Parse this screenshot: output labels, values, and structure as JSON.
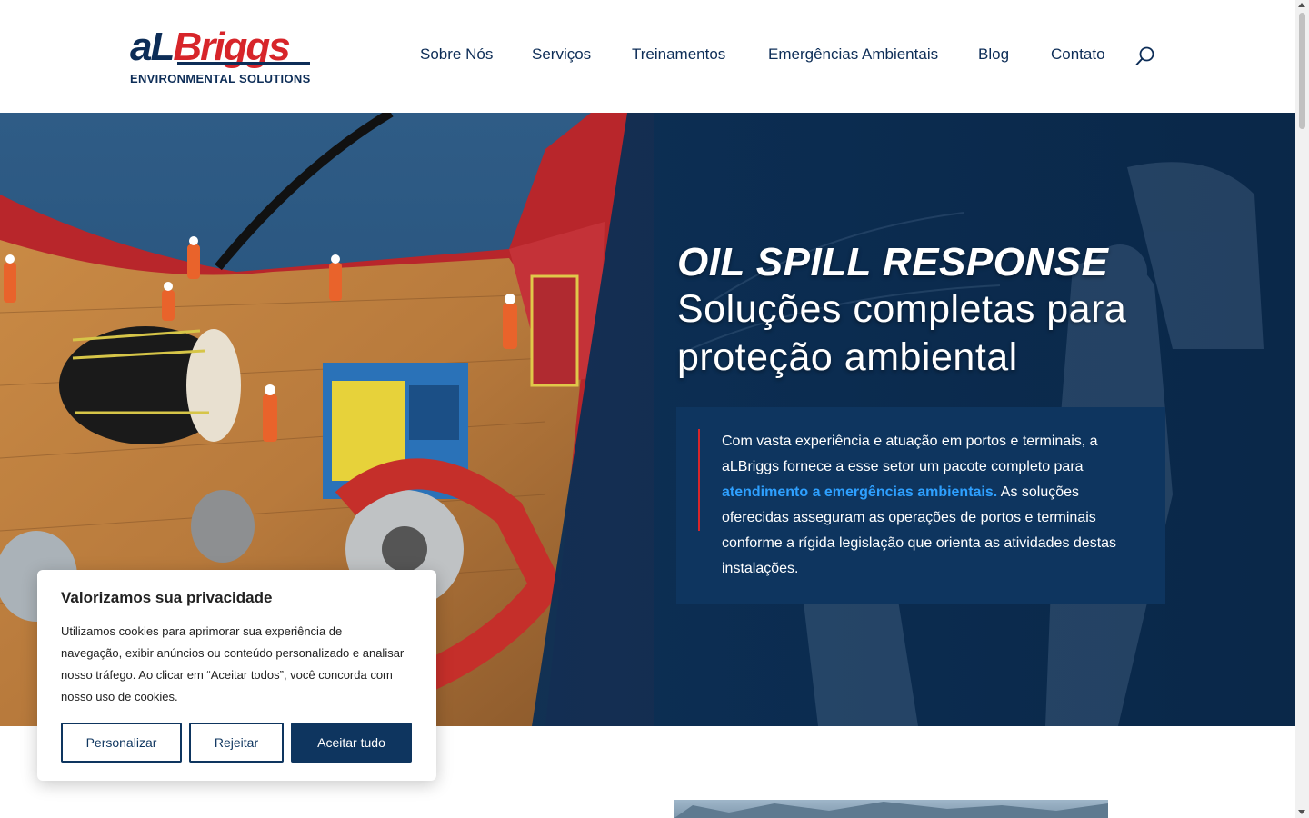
{
  "header": {
    "logo": {
      "main_a": "aL",
      "main_b": "Briggs",
      "sub": "ENVIRONMENTAL SOLUTIONS"
    },
    "nav": [
      {
        "label": "Sobre Nós"
      },
      {
        "label": "Serviços"
      },
      {
        "label": "Treinamentos"
      },
      {
        "label": "Emergências Ambientais"
      },
      {
        "label": "Blog"
      },
      {
        "label": "Contato"
      }
    ]
  },
  "hero": {
    "title": "OIL SPILL RESPONSE",
    "subtitle_line1": "Soluções completas para",
    "subtitle_line2": "proteção ambiental",
    "body_before": "Com vasta experiência e atuação em portos e terminais, a aLBriggs fornece a esse setor um pacote completo para ",
    "body_link": "atendimento a emergências ambientais.",
    "body_after": " As soluções oferecidas asseguram as operações de portos e terminais conforme a rígida legislação que orienta as atividades destas instalações."
  },
  "cookie": {
    "title": "Valorizamos sua privacidade",
    "text": "Utilizamos cookies para aprimorar sua experiência de navegação, exibir anúncios ou conteúdo personalizado e analisar nosso tráfego. Ao clicar em “Aceitar todos”, você concorda com nosso uso de cookies.",
    "buttons": {
      "customize": "Personalizar",
      "reject": "Rejeitar",
      "accept": "Aceitar tudo"
    }
  },
  "colors": {
    "navy": "#0d2d57",
    "brand_red": "#d7252a",
    "panel_blue": "#0e355f",
    "link_blue": "#2ea0ff"
  },
  "icons": {
    "search": "search-icon"
  }
}
